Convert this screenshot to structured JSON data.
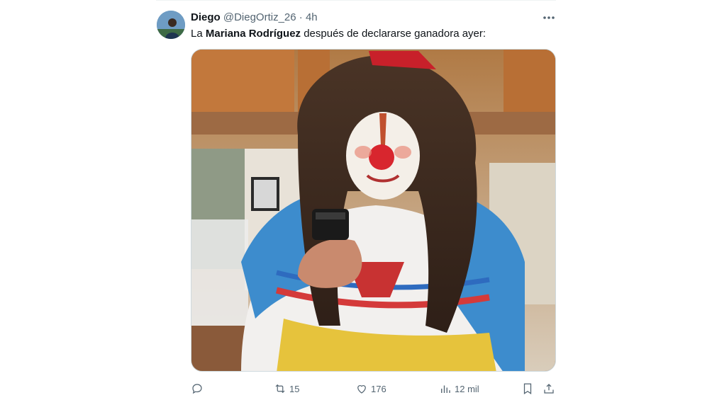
{
  "tweet": {
    "author_name": "Diego",
    "handle": "@DiegOrtiz_26",
    "separator": "·",
    "time": "4h",
    "text_before": "La ",
    "text_bold": "Mariana Rodríguez",
    "text_after": " después de declararse ganadora ayer:"
  },
  "actions": {
    "reply_count": "",
    "retweet_count": "15",
    "like_count": "176",
    "views_count": "12 mil"
  },
  "icons": {
    "more": "more-icon",
    "reply": "reply-icon",
    "retweet": "retweet-icon",
    "like": "heart-icon",
    "views": "views-icon",
    "bookmark": "bookmark-icon",
    "share": "share-icon"
  },
  "colors": {
    "text_primary": "#0f1419",
    "text_secondary": "#536471",
    "border": "#cfd9de"
  }
}
